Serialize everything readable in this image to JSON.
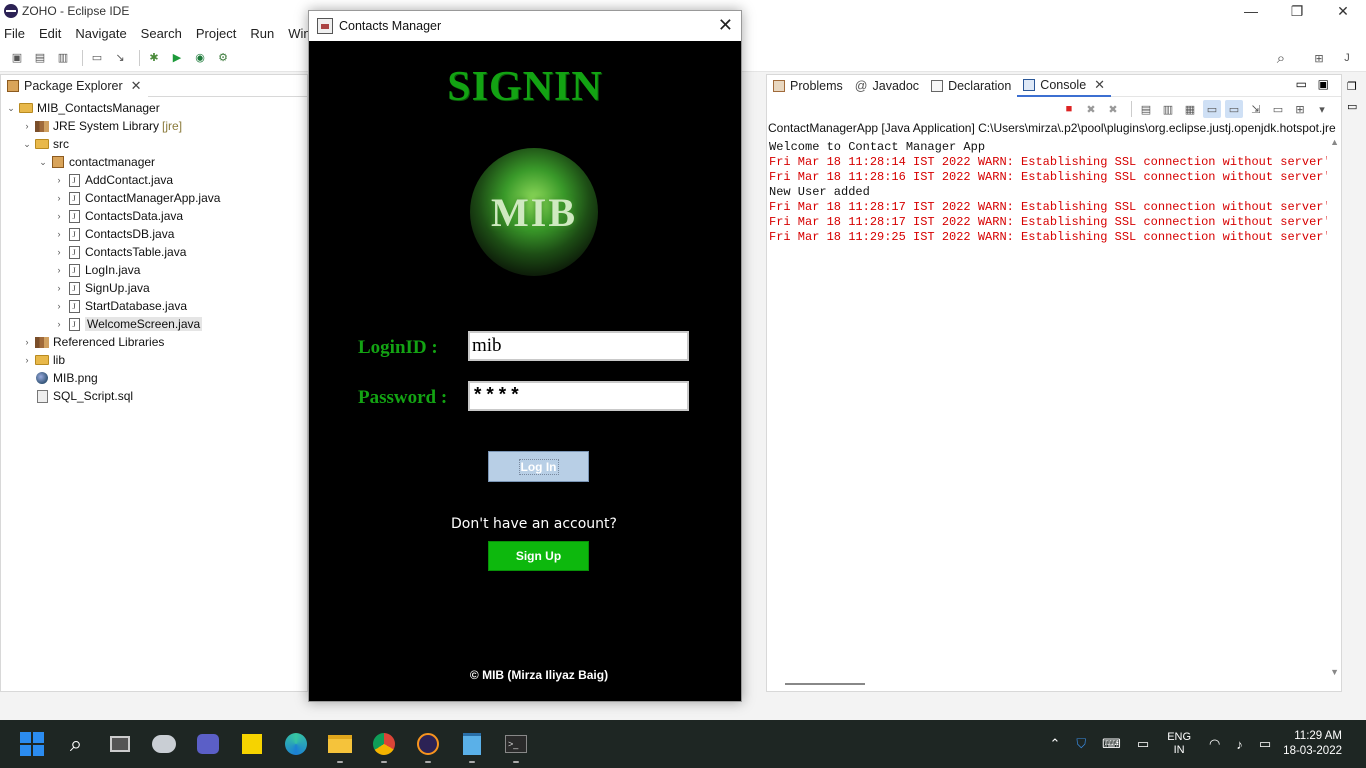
{
  "eclipse": {
    "title": "ZOHO - Eclipse IDE",
    "menu": [
      "File",
      "Edit",
      "Navigate",
      "Search",
      "Project",
      "Run",
      "Window"
    ]
  },
  "package_explorer": {
    "tab_label": "Package Explorer",
    "project": "MIB_ContactsManager",
    "jre": "JRE System Library",
    "jre_tag": "[jre]",
    "src": "src",
    "package": "contactmanager",
    "files": [
      "AddContact.java",
      "ContactManagerApp.java",
      "ContactsData.java",
      "ContactsDB.java",
      "ContactsTable.java",
      "LogIn.java",
      "SignUp.java",
      "StartDatabase.java",
      "WelcomeScreen.java"
    ],
    "referenced_libraries": "Referenced Libraries",
    "lib": "lib",
    "png": "MIB.png",
    "sql": "SQL_Script.sql"
  },
  "console_panel": {
    "tabs": [
      "Problems",
      "Javadoc",
      "Declaration",
      "Console"
    ],
    "header": "ContactManagerApp [Java Application] C:\\Users\\mirza\\.p2\\pool\\plugins\\org.eclipse.justj.openjdk.hotspot.jre",
    "lines": [
      {
        "text": "Welcome to Contact Manager App",
        "type": "info"
      },
      {
        "text": "Fri Mar 18 11:28:14 IST 2022 WARN: Establishing SSL connection without server's",
        "type": "warn"
      },
      {
        "text": "Fri Mar 18 11:28:16 IST 2022 WARN: Establishing SSL connection without server's",
        "type": "warn"
      },
      {
        "text": "New User added",
        "type": "info"
      },
      {
        "text": "Fri Mar 18 11:28:17 IST 2022 WARN: Establishing SSL connection without server's",
        "type": "warn"
      },
      {
        "text": "Fri Mar 18 11:28:17 IST 2022 WARN: Establishing SSL connection without server's",
        "type": "warn"
      },
      {
        "text": "Fri Mar 18 11:29:25 IST 2022 WARN: Establishing SSL connection without server's",
        "type": "warn"
      }
    ]
  },
  "dialog": {
    "title": "Contacts Manager",
    "heading": "SIGNIN",
    "logo_text": "MIB",
    "login_label": "LoginID :",
    "login_value": "mib",
    "password_label": "Password :",
    "password_value": "****",
    "login_button": "Log In",
    "no_account": "Don't have an account?",
    "signup_button": "Sign Up",
    "footer": "© MIB (Mirza Iliyaz Baig)"
  },
  "taskbar": {
    "lang_line1": "ENG",
    "lang_line2": "IN",
    "time": "11:29 AM",
    "date": "18-03-2022"
  },
  "colors": {
    "heading_green": "#13a313",
    "signup_green": "#0db80d",
    "warn_red": "#d60000"
  }
}
